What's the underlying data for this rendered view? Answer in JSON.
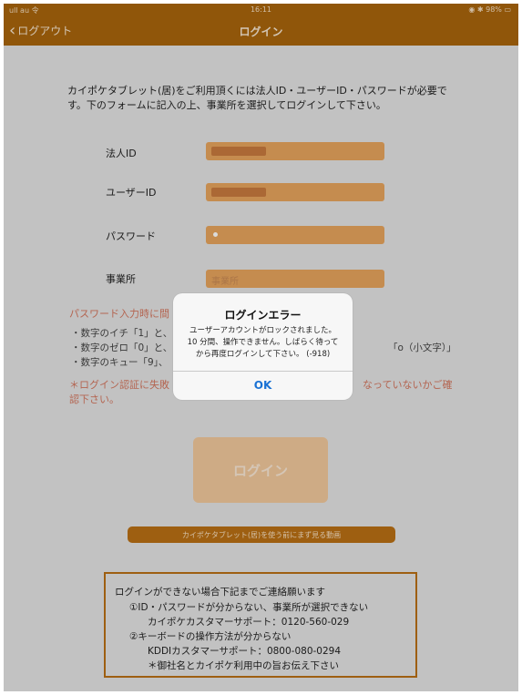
{
  "status": {
    "left": "ull au 令",
    "time": "16:11",
    "right": "◉ ✱ 98% ▭"
  },
  "nav": {
    "back": "ログアウト",
    "title": "ログイン"
  },
  "intro": {
    "line1": "カイポケタブレット(居)をご利用頂くには法人ID・ユーザーID・パスワードが必要で",
    "line2": "す。下のフォームに記入の上、事業所を選択してログインして下さい。"
  },
  "form": {
    "corp_id": {
      "label": "法人ID"
    },
    "user_id": {
      "label": "ユーザーID"
    },
    "password": {
      "label": "パスワード"
    },
    "office": {
      "label": "事業所",
      "placeholder": "事業所"
    }
  },
  "warning": {
    "text": "パスワード入力時に間"
  },
  "notes": {
    "n1": "・数字のイチ「1」と、",
    "n2": "・数字のゼロ「0」と、",
    "n2_tail": "「o（小文字）」",
    "n3": "・数字のキュー「9」、"
  },
  "error_note": {
    "l1": "＊ログイン認証に失敗",
    "l1_tail": "なっていないかご確",
    "l2": "認下さい。"
  },
  "buttons": {
    "login": "ログイン",
    "video": "カイポケタブレット(居)を使う前にまず見る動画"
  },
  "support": {
    "l1": "ログインができない場合下記までご連絡願います",
    "l2": "①ID・パスワードが分からない、事業所が選択できない",
    "l3": "カイポケカスタマーサポート：0120-560-029",
    "l4": "②キーボードの操作方法が分からない",
    "l5": "KDDIカスタマーサポート：0800-080-0294",
    "l6": "＊御社名とカイポケ利用中の旨お伝え下さい"
  },
  "dialog": {
    "title": "ログインエラー",
    "msg1": "ユーザーアカウントがロックされました。",
    "msg2": "10 分間、操作できません。しばらく待って",
    "msg3": "から再度ログインして下さい。 (-918)",
    "ok": "OK"
  }
}
